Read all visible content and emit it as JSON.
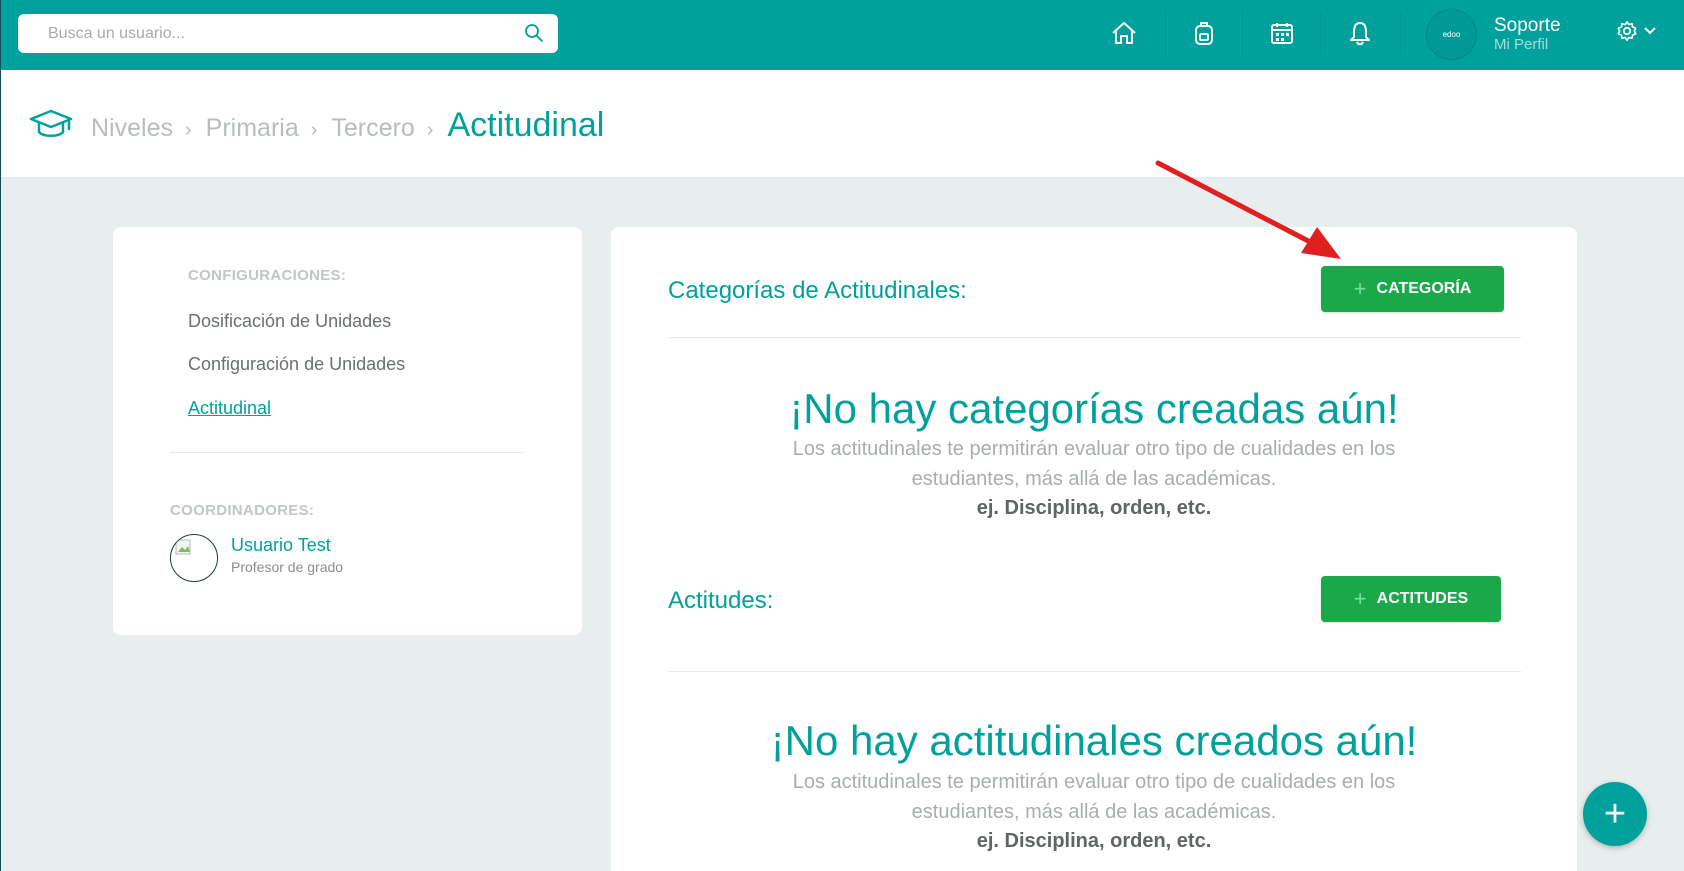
{
  "search": {
    "placeholder": "Busca un usuario..."
  },
  "nav": {
    "icons": [
      "home-icon",
      "backpack-icon",
      "calendar-icon",
      "bell-icon"
    ],
    "avatar_text": "edoo",
    "profile_name": "Soporte",
    "profile_sub": "Mi Perfil"
  },
  "breadcrumb": {
    "items": [
      "Niveles",
      "Primaria",
      "Tercero"
    ],
    "current": "Actitudinal"
  },
  "sidebar": {
    "config_title": "CONFIGURACIONES:",
    "items": [
      {
        "label": "Dosificación de Unidades",
        "active": false
      },
      {
        "label": "Configuración de Unidades",
        "active": false
      },
      {
        "label": "Actitudinal",
        "active": true
      }
    ],
    "coord_title": "COORDINADORES:",
    "coordinator": {
      "name": "Usuario Test",
      "role": "Profesor de grado"
    }
  },
  "main": {
    "categories": {
      "title": "Categorías de Actitudinales:",
      "button": "CATEGORÍA",
      "empty_title": "¡No hay categorías creadas aún!",
      "empty_desc": "Los actitudinales te permitirán evaluar otro tipo de cualidades en los estudiantes, más allá de las académicas.",
      "empty_example": "ej. Disciplina, orden, etc."
    },
    "attitudes": {
      "title": "Actitudes:",
      "button": "ACTITUDES",
      "empty_title": "¡No hay actitudinales creados aún!",
      "empty_desc": "Los actitudinales te permitirán evaluar otro tipo de cualidades en los estudiantes, más allá de las académicas.",
      "empty_example": "ej. Disciplina, orden, etc."
    }
  },
  "fab": {
    "label": "+"
  },
  "colors": {
    "primary": "#00a19d",
    "button_green": "#1aa84a",
    "arrow_red": "#e02020"
  }
}
